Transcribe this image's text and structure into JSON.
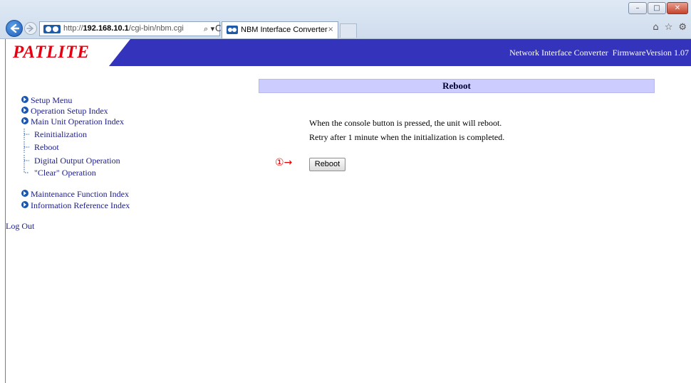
{
  "browser": {
    "url_host": "192.168.10.1",
    "url_prefix": "http://",
    "url_path": "/cgi-bin/nbm.cgi",
    "tab_title": "NBM Interface Converter",
    "tab_close": "×",
    "search_icon": "⌕ ▾",
    "refresh_icon": "C",
    "icons": [
      "home-icon",
      "star-icon",
      "gear-icon"
    ]
  },
  "banner": {
    "logo": "PATLITE",
    "product": "Network Interface Converter",
    "firmware": "FirmwareVersion 1.07",
    "colors": {
      "banner": "#3333bb",
      "logo": "#e60012"
    }
  },
  "menu": {
    "setup_menu": "Setup Menu",
    "operation_setup_index": "Operation Setup Index",
    "main_unit_operation_index": "Main Unit Operation Index",
    "sub_items": [
      "Reinitialization",
      "Reboot",
      "Digital Output Operation",
      "\"Clear\" Operation"
    ],
    "maintenance_function_index": "Maintenance Function Index",
    "information_reference_index": "Information Reference Index",
    "log_out": "Log Out"
  },
  "main": {
    "title": "Reboot",
    "line1": "When the console button is pressed, the unit will reboot.",
    "line2": "Retry after 1 minute when the initialization is completed.",
    "marker": "①→",
    "button_label": "Reboot"
  }
}
